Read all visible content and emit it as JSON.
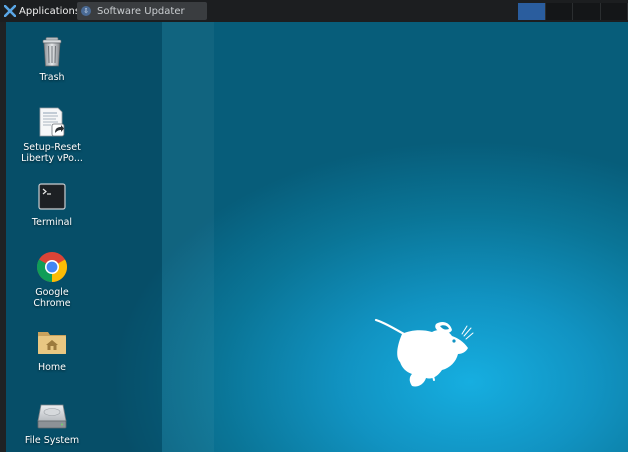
{
  "panel": {
    "applications_label": "Applications",
    "separator": "⁝",
    "task": {
      "label": "Software Updater",
      "icon": "updater-icon"
    },
    "workspaces": [
      {
        "id": 1,
        "active": true
      },
      {
        "id": 2,
        "active": false
      },
      {
        "id": 3,
        "active": false
      },
      {
        "id": 4,
        "active": false
      }
    ]
  },
  "desktop": {
    "icons": [
      {
        "name": "trash",
        "label": "Trash",
        "icon": "trash-icon"
      },
      {
        "name": "setup-reset",
        "label_line1": "Setup-Reset",
        "label_line2": "Liberty vPo...",
        "icon": "document-shortcut-icon"
      },
      {
        "name": "terminal",
        "label": "Terminal",
        "icon": "terminal-icon"
      },
      {
        "name": "google-chrome",
        "label_line1": "Google",
        "label_line2": "Chrome",
        "icon": "chrome-icon"
      },
      {
        "name": "home",
        "label": "Home",
        "icon": "home-folder-icon"
      },
      {
        "name": "file-system",
        "label": "File System",
        "icon": "drive-icon"
      }
    ],
    "wallpaper": {
      "logo": "xfce-mouse-logo"
    }
  },
  "colors": {
    "panel_bg": "#1c1e20",
    "workspace_active": "#2a5d9e",
    "desktop_glow": "#16aee0",
    "desktop_dark": "#075d7a"
  }
}
